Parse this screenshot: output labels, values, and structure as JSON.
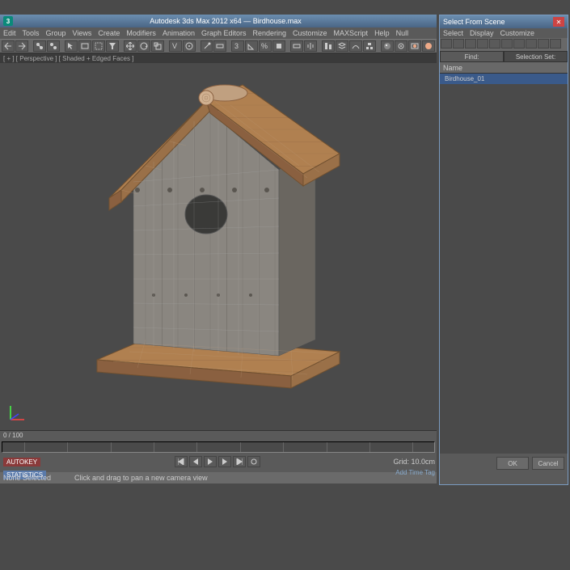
{
  "app": {
    "title": "Autodesk 3ds Max 2012 x64 — Birdhouse.max",
    "icon_label": "3"
  },
  "menu": {
    "items": [
      "Edit",
      "Tools",
      "Group",
      "Views",
      "Create",
      "Modifiers",
      "Animation",
      "Graph Editors",
      "Rendering",
      "Customize",
      "MAXScript",
      "Help",
      "Null"
    ]
  },
  "viewport": {
    "label": "[ + ] [ Perspective ] [ Shaded + Edged Faces ]"
  },
  "timeline": {
    "frame_label": "0 / 100"
  },
  "status": {
    "tag1": "AUTOKEY",
    "tag2": "STATISTICS",
    "selection": "None Selected",
    "prompt": "Click and drag to pan a new camera view",
    "grid": "Grid: 10.0cm",
    "addtime": "Add Time Tag"
  },
  "side": {
    "title": "Select From Scene",
    "menu": [
      "Select",
      "Display",
      "Customize"
    ],
    "tabs": {
      "find": "Find:",
      "selset": "Selection Set:"
    },
    "header": "Name",
    "items": [
      "Birdhouse_01"
    ],
    "ok": "OK",
    "cancel": "Cancel"
  },
  "icons": {
    "arrow": "arrow-icon",
    "move": "move-icon",
    "rotate": "rotate-icon",
    "scale": "scale-icon",
    "select": "select-icon",
    "snap": "snap-icon"
  }
}
